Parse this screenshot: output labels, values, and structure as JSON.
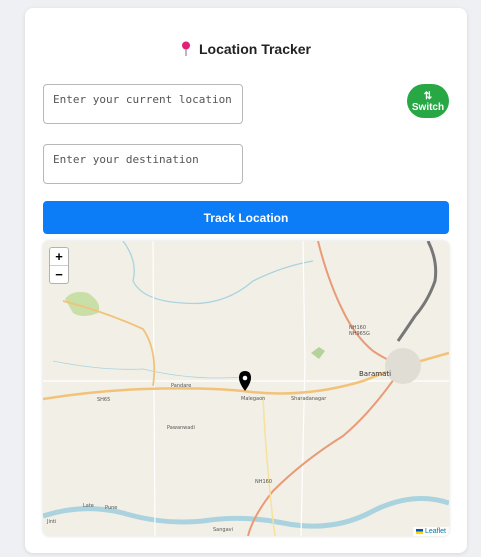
{
  "header": {
    "title": "Location Tracker",
    "pin_icon": "pushpin-icon"
  },
  "form": {
    "current_placeholder": "Enter your current location",
    "destination_placeholder": "Enter your destination",
    "switch_symbol": "⇅",
    "switch_label": "Switch",
    "track_label": "Track Location"
  },
  "map": {
    "zoom_in": "+",
    "zoom_out": "−",
    "attribution": "Leaflet",
    "labels": {
      "baramati": "Baramati",
      "pandare": "Pandare",
      "malegaon": "Malegaon",
      "sharadanagar": "Sharadanagar",
      "pawanwadi": "Pawanwadi",
      "sh65": "SH65",
      "nh160_a": "NH160",
      "nh965g": "NH965G",
      "nh160_b": "NH160",
      "late": "Late",
      "pune": "Pune",
      "jinti": "Jinti",
      "sangavi": "Sangavi"
    },
    "colors": {
      "road_major": "#e99b78",
      "road_state": "#f2c27a",
      "river": "#aad3df",
      "green": "#c9dfa8"
    }
  }
}
